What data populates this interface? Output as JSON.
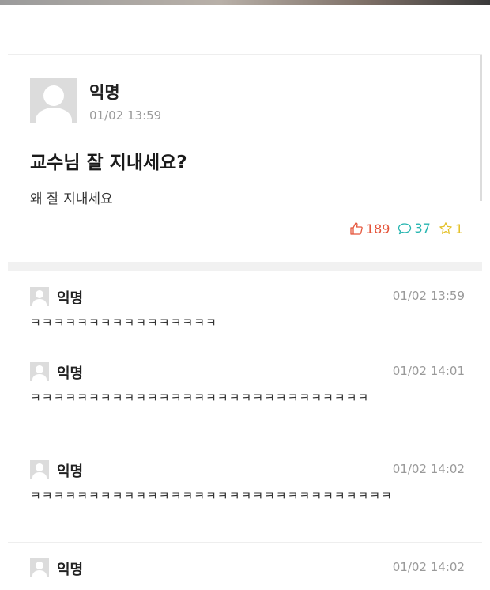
{
  "post": {
    "author": "익명",
    "date": "01/02 13:59",
    "title": "교수님 잘 지내세요?",
    "body": "왜 잘 지내세요",
    "likes": "189",
    "comments": "37",
    "scraps": "1",
    "colors": {
      "like": "#e5543a",
      "comment": "#26b5b0",
      "scrap": "#e4c12a"
    }
  },
  "comments": [
    {
      "author": "익명",
      "time": "01/02 13:59",
      "text": "ㅋㅋㅋㅋㅋㅋㅋㅋㅋㅋㅋㅋㅋㅋㅋㅋ"
    },
    {
      "author": "익명",
      "time": "01/02 14:01",
      "text": "ㅋㅋㅋㅋㅋㅋㅋㅋㅋㅋㅋㅋㅋㅋㅋㅋㅋㅋㅋㅋㅋㅋㅋㅋㅋㅋㅋㅋㅋ"
    },
    {
      "author": "익명",
      "time": "01/02 14:02",
      "text": "ㅋㅋㅋㅋㅋㅋㅋㅋㅋㅋㅋㅋㅋㅋㅋㅋㅋㅋㅋㅋㅋㅋㅋㅋㅋㅋㅋㅋㅋㅋㅋ"
    },
    {
      "author": "익명",
      "time": "01/02 14:02"
    }
  ]
}
